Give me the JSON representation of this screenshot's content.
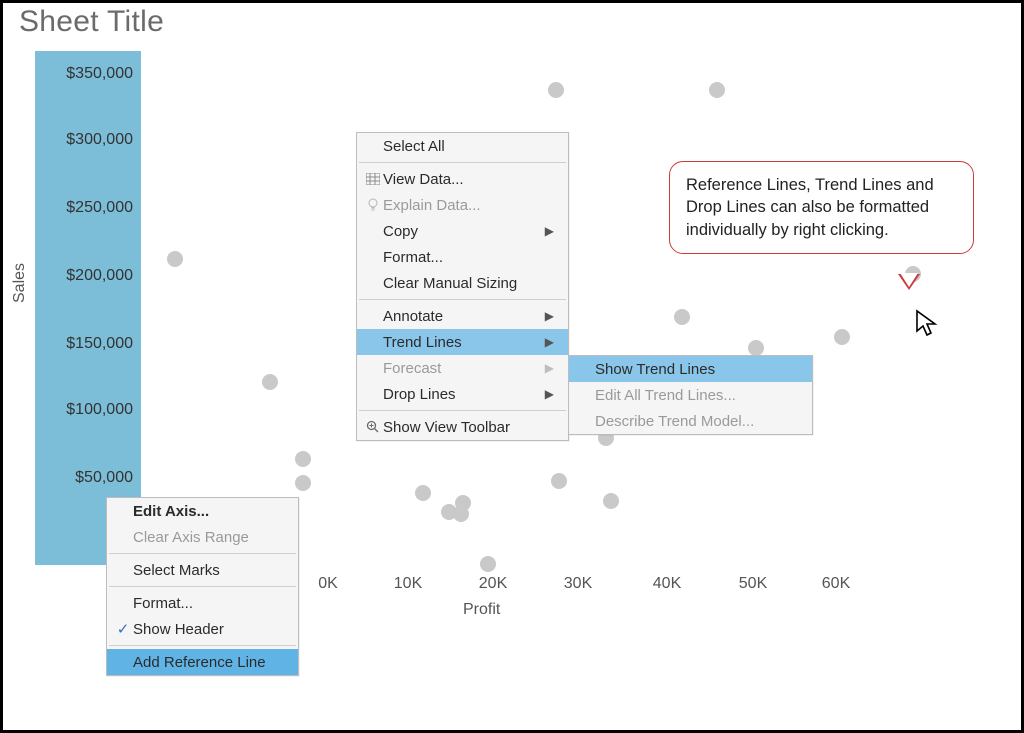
{
  "sheet_title": "Sheet Title",
  "yaxis": {
    "label": "Sales",
    "ticks": [
      "$350,000",
      "$300,000",
      "$250,000",
      "$200,000",
      "$150,000",
      "$100,000",
      "$50,000"
    ]
  },
  "xaxis": {
    "label": "Profit",
    "ticks": [
      "0K",
      "10K",
      "20K",
      "30K",
      "40K",
      "50K",
      "60K"
    ]
  },
  "menu_main": {
    "select_all": "Select All",
    "view_data": "View Data...",
    "explain_data": "Explain Data...",
    "copy": "Copy",
    "format": "Format...",
    "clear_manual_sizing": "Clear Manual Sizing",
    "annotate": "Annotate",
    "trend_lines": "Trend Lines",
    "forecast": "Forecast",
    "drop_lines": "Drop Lines",
    "show_view_toolbar": "Show View Toolbar"
  },
  "menu_trend": {
    "show": "Show Trend Lines",
    "edit_all": "Edit All Trend Lines...",
    "describe": "Describe Trend Model..."
  },
  "menu_axis": {
    "edit_axis": "Edit Axis...",
    "clear_range": "Clear Axis Range",
    "select_marks": "Select Marks",
    "format": "Format...",
    "show_header": "Show Header",
    "add_reference": "Add Reference Line"
  },
  "callout": "Reference Lines, Trend Lines and Drop Lines can also be formatted individually by right clicking.",
  "chart_data": {
    "type": "scatter",
    "title": "Sheet Title",
    "xlabel": "Profit",
    "ylabel": "Sales",
    "xlim": [
      -20000,
      65000
    ],
    "ylim": [
      0,
      370000
    ],
    "xticks": [
      0,
      10000,
      20000,
      30000,
      40000,
      50000,
      60000
    ],
    "yticks": [
      50000,
      100000,
      150000,
      200000,
      250000,
      300000,
      350000
    ],
    "series": [
      {
        "name": "marks",
        "points": [
          {
            "x": 5000,
            "y": 200000
          },
          {
            "x": -7000,
            "y": 100000
          },
          {
            "x": -3000,
            "y": 80000
          },
          {
            "x": 10000,
            "y": 56000
          },
          {
            "x": 15000,
            "y": 50000
          },
          {
            "x": 16500,
            "y": 44000
          },
          {
            "x": 18000,
            "y": 45000
          },
          {
            "x": 22000,
            "y": 0
          },
          {
            "x": 25000,
            "y": 333000
          },
          {
            "x": 27000,
            "y": 65000
          },
          {
            "x": 33000,
            "y": 333000
          },
          {
            "x": 33000,
            "y": 50000
          },
          {
            "x": 42000,
            "y": 162000
          },
          {
            "x": 43000,
            "y": 217000
          },
          {
            "x": 45000,
            "y": 190000
          },
          {
            "x": 50000,
            "y": 161000
          },
          {
            "x": 55000,
            "y": 233000
          },
          {
            "x": 58000,
            "y": 145000
          }
        ]
      }
    ]
  }
}
